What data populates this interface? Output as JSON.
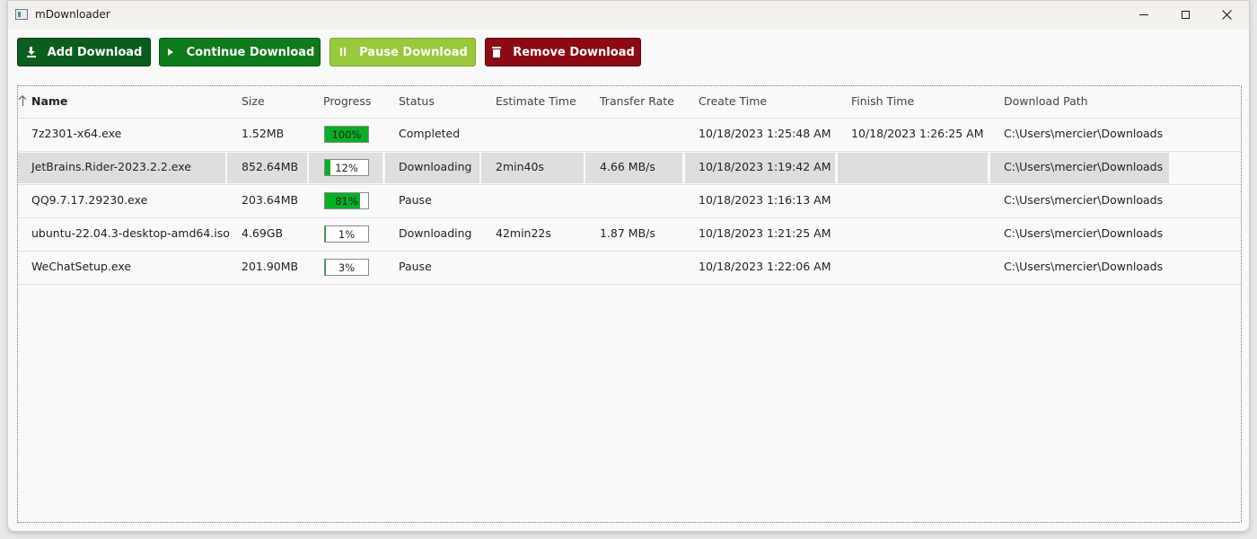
{
  "window": {
    "title": "mDownloader"
  },
  "toolbar": {
    "add_label": "Add Download",
    "continue_label": "Continue Download",
    "pause_label": "Pause Download",
    "remove_label": "Remove Download"
  },
  "columns": [
    "Name",
    "Size",
    "Progress",
    "Status",
    "Estimate Time",
    "Transfer Rate",
    "Create Time",
    "Finish Time",
    "Download Path"
  ],
  "rows": [
    {
      "name": "7z2301-x64.exe",
      "size": "1.52MB",
      "progress": 100,
      "progress_label": "100%",
      "status": "Completed",
      "estimate": "",
      "rate": "",
      "create": "10/18/2023 1:25:48 AM",
      "finish": "10/18/2023 1:26:25 AM",
      "path": "C:\\Users\\mercier\\Downloads"
    },
    {
      "name": "JetBrains.Rider-2023.2.2.exe",
      "size": "852.64MB",
      "progress": 12,
      "progress_label": "12%",
      "status": "Downloading",
      "estimate": "2min40s",
      "rate": "4.66 MB/s",
      "create": "10/18/2023 1:19:42 AM",
      "finish": "",
      "path": "C:\\Users\\mercier\\Downloads",
      "selected": true
    },
    {
      "name": "QQ9.7.17.29230.exe",
      "size": "203.64MB",
      "progress": 81,
      "progress_label": "81%",
      "status": "Pause",
      "estimate": "",
      "rate": "",
      "create": "10/18/2023 1:16:13 AM",
      "finish": "",
      "path": "C:\\Users\\mercier\\Downloads"
    },
    {
      "name": "ubuntu-22.04.3-desktop-amd64.iso",
      "size": "4.69GB",
      "progress": 1,
      "progress_label": "1%",
      "status": "Downloading",
      "estimate": "42min22s",
      "rate": "1.87 MB/s",
      "create": "10/18/2023 1:21:25 AM",
      "finish": "",
      "path": "C:\\Users\\mercier\\Downloads"
    },
    {
      "name": "WeChatSetup.exe",
      "size": "201.90MB",
      "progress": 3,
      "progress_label": "3%",
      "status": "Pause",
      "estimate": "",
      "rate": "",
      "create": "10/18/2023 1:22:06 AM",
      "finish": "",
      "path": "C:\\Users\\mercier\\Downloads"
    }
  ],
  "colors": {
    "progress_fill": "#06b025",
    "add": "#0b5d1e",
    "continue": "#0f7a1a",
    "pause": "#98c93c",
    "remove": "#8b0a14",
    "selected_row": "#dedede"
  }
}
